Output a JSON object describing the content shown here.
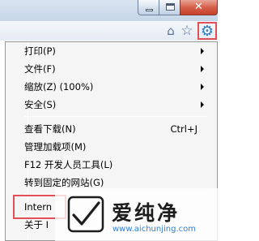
{
  "window": {
    "close_glyph": "✕"
  },
  "toolbar": {
    "home_icon": "⌂",
    "favorites_icon": "☆",
    "tools_icon": "⚙"
  },
  "menu": {
    "items": [
      {
        "label": "打印(P)",
        "submenu": true
      },
      {
        "label": "文件(F)",
        "submenu": true
      },
      {
        "label": "缩放(Z) (100%)",
        "submenu": true
      },
      {
        "label": "安全(S)",
        "submenu": true
      },
      {
        "label": "查看下载(N)",
        "shortcut": "Ctrl+J"
      },
      {
        "label": "管理加载项(M)"
      },
      {
        "label": "F12 开发人员工具(L)"
      },
      {
        "label": "转到固定的网站(G)"
      },
      {
        "label": "Intern"
      },
      {
        "label": "关于 I"
      }
    ]
  },
  "watermark": {
    "title": "爱纯净",
    "url": "www.aichunjing.com"
  },
  "colors": {
    "highlight_border": "#e34f56",
    "menu_background": "#f5f5f5",
    "tools_icon": "#2f7ac0"
  }
}
